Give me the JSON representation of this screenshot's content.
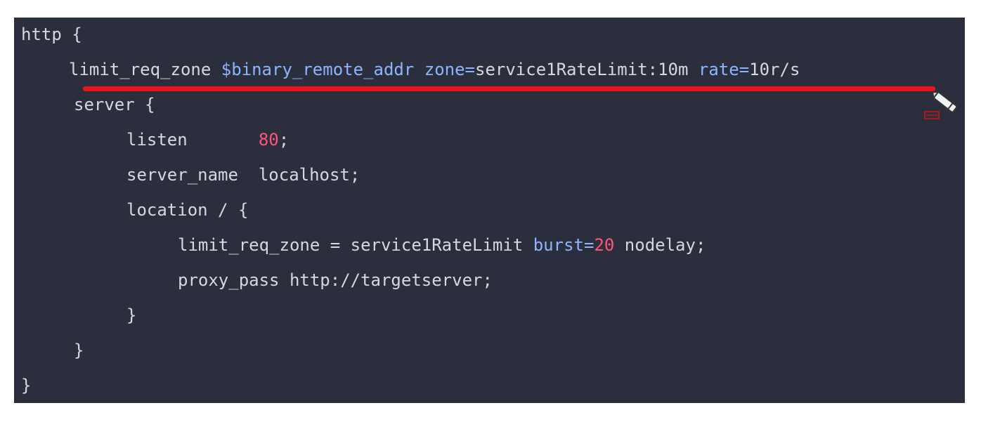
{
  "code": {
    "lines": [
      [
        {
          "t": "http {",
          "c": "plain"
        }
      ],
      [
        {
          "t": "limit_req_zone ",
          "c": "plain"
        },
        {
          "t": "$binary_remote_addr",
          "c": "kw-blue"
        },
        {
          "t": " ",
          "c": "plain"
        },
        {
          "t": "zone=",
          "c": "kw-blue"
        },
        {
          "t": "service1RateLimit:10m ",
          "c": "plain"
        },
        {
          "t": "rate=",
          "c": "kw-blue"
        },
        {
          "t": "10r/s",
          "c": "plain"
        }
      ],
      [
        {
          "t": "server {",
          "c": "plain"
        }
      ],
      [
        {
          "t": "listen       ",
          "c": "plain"
        },
        {
          "t": "80",
          "c": "num-red"
        },
        {
          "t": ";",
          "c": "plain"
        }
      ],
      [
        {
          "t": "server_name  localhost;",
          "c": "plain"
        }
      ],
      [
        {
          "t": "location / {",
          "c": "plain"
        }
      ],
      [
        {
          "t": "limit_req_zone = service1RateLimit ",
          "c": "plain"
        },
        {
          "t": "burst=",
          "c": "kw-blue"
        },
        {
          "t": "20",
          "c": "num-red"
        },
        {
          "t": " nodelay;",
          "c": "plain"
        }
      ],
      [
        {
          "t": "proxy_pass http://targetserver;",
          "c": "plain"
        }
      ],
      [
        {
          "t": "}",
          "c": "plain"
        }
      ],
      [
        {
          "t": "}",
          "c": "plain"
        }
      ],
      [
        {
          "t": "}",
          "c": "plain"
        }
      ]
    ]
  },
  "annotation": {
    "underline_color": "#e8131d",
    "tool_icon": "pen-icon"
  },
  "colors": {
    "background": "#2a2e3d",
    "text": "#d6d8de",
    "keyword": "#8fb4ff",
    "number": "#ff5577"
  }
}
